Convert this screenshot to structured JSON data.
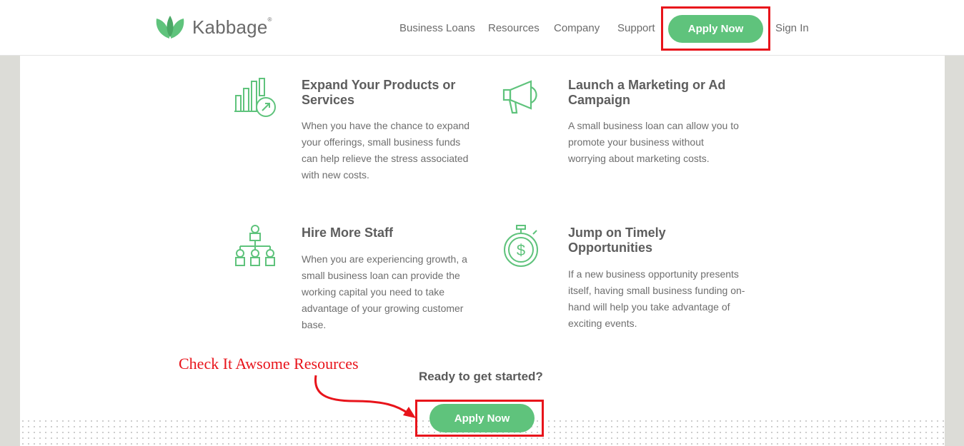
{
  "brand": {
    "name": "Kabbage",
    "registered_mark": "®",
    "color": "#5fc37c"
  },
  "nav": {
    "items": [
      {
        "label": "Business Loans"
      },
      {
        "label": "Resources"
      },
      {
        "label": "Company"
      },
      {
        "label": "Support"
      }
    ],
    "apply_label": "Apply Now",
    "sign_in_label": "Sign In"
  },
  "features": [
    {
      "icon": "growth-chart-icon",
      "title": "Expand Your Products or Services",
      "description": "When you have the chance to expand your offerings, small business funds can help relieve the stress associated with new costs."
    },
    {
      "icon": "megaphone-icon",
      "title": "Launch a Marketing or Ad Campaign",
      "description": "A small business loan can allow you to promote your business without worrying about marketing costs."
    },
    {
      "icon": "org-chart-icon",
      "title": "Hire More Staff",
      "description": "When you are experiencing growth, a small business loan can provide the working capital you need to take advantage of your growing customer base."
    },
    {
      "icon": "stopwatch-dollar-icon",
      "title": "Jump on Timely Opportunities",
      "description": "If a new business opportunity presents itself, having small business funding on-hand will help you take advantage of exciting events."
    }
  ],
  "annotation": {
    "text": "Check It Awsome Resources",
    "color": "#e8141b"
  },
  "cta": {
    "prompt": "Ready to get started?",
    "button_label": "Apply Now"
  }
}
